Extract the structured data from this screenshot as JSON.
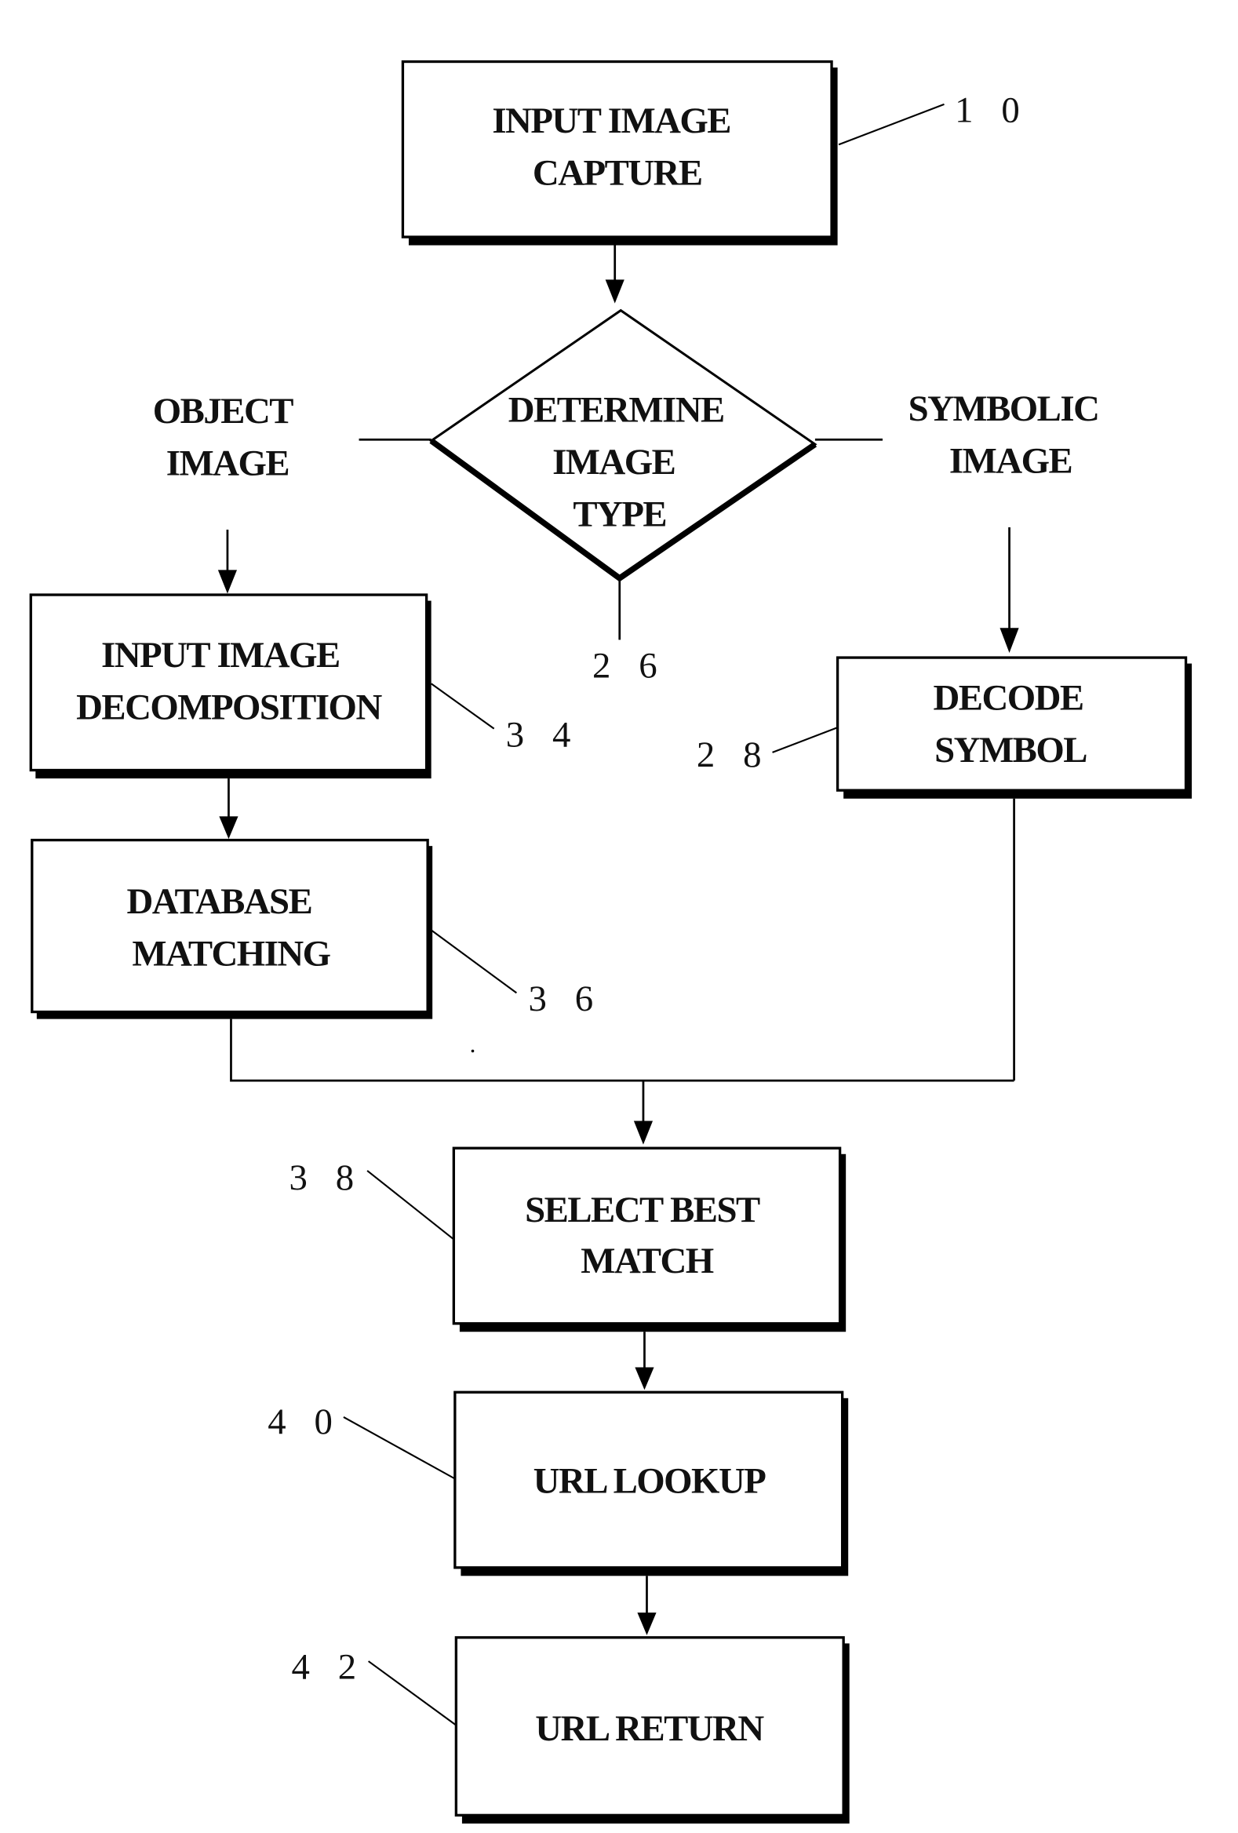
{
  "figure": {
    "type": "flowchart",
    "nodes": {
      "capture": {
        "ref": "1 0",
        "lines": [
          "INPUT IMAGE",
          "CAPTURE"
        ]
      },
      "determine": {
        "ref": "2 6",
        "lines": [
          "DETERMINE",
          "IMAGE",
          "TYPE"
        ]
      },
      "decomposition": {
        "ref": "3 4",
        "lines": [
          "INPUT IMAGE",
          "DECOMPOSITION"
        ]
      },
      "matching": {
        "ref": "3 6",
        "lines": [
          "DATABASE",
          "MATCHING"
        ]
      },
      "decode": {
        "ref": "2 8",
        "lines": [
          "DECODE",
          "SYMBOL"
        ]
      },
      "select": {
        "ref": "3 8",
        "lines": [
          "SELECT BEST",
          "MATCH"
        ]
      },
      "lookup": {
        "ref": "4 0",
        "lines": [
          "URL LOOKUP"
        ]
      },
      "return": {
        "ref": "4 2",
        "lines": [
          "URL RETURN"
        ]
      }
    },
    "branches": {
      "left": [
        "OBJECT",
        "IMAGE"
      ],
      "right": [
        "SYMBOLIC",
        "IMAGE"
      ]
    },
    "edges": [
      [
        "capture",
        "determine"
      ],
      [
        "determine",
        "decomposition",
        "OBJECT IMAGE"
      ],
      [
        "determine",
        "decode",
        "SYMBOLIC IMAGE"
      ],
      [
        "decomposition",
        "matching"
      ],
      [
        "matching",
        "select"
      ],
      [
        "decode",
        "select"
      ],
      [
        "select",
        "lookup"
      ],
      [
        "lookup",
        "return"
      ]
    ]
  }
}
